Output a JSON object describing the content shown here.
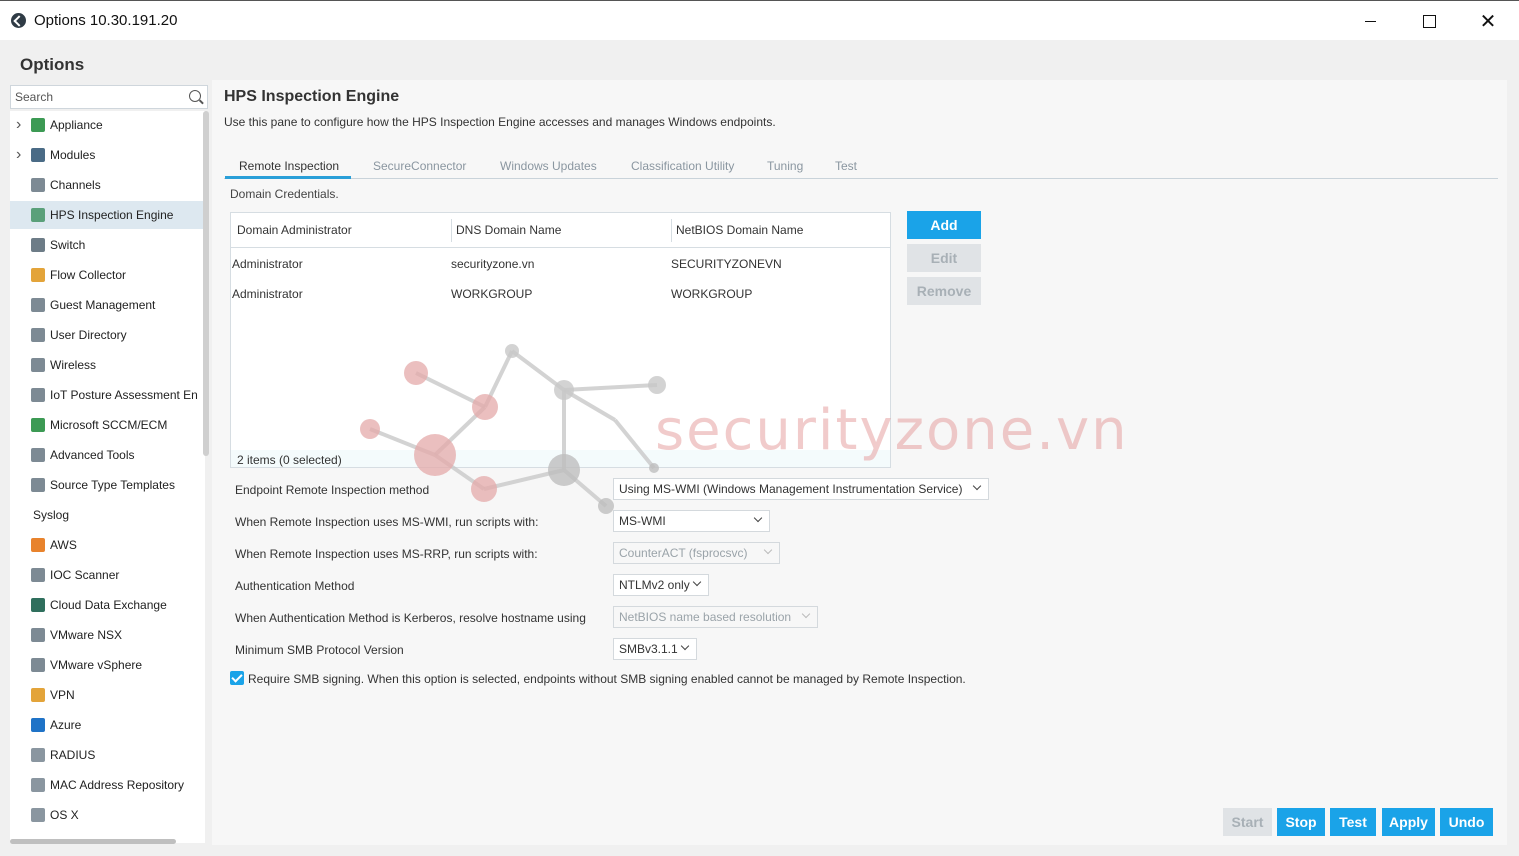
{
  "window": {
    "title": "Options 10.30.191.20"
  },
  "sidebar": {
    "heading": "Options",
    "search_placeholder": "Search",
    "items": [
      {
        "label": "Appliance",
        "expandable": true,
        "icon": "appliance-icon",
        "color": "#3c9a54"
      },
      {
        "label": "Modules",
        "expandable": true,
        "icon": "modules-icon",
        "color": "#4a6b86"
      },
      {
        "label": "Channels",
        "expandable": false,
        "icon": "channels-icon",
        "color": "#7d8a94"
      },
      {
        "label": "HPS Inspection Engine",
        "expandable": false,
        "icon": "hps-icon",
        "color": "#5aa07a",
        "selected": true
      },
      {
        "label": "Switch",
        "expandable": false,
        "icon": "switch-icon",
        "color": "#6d7c87"
      },
      {
        "label": "Flow Collector",
        "expandable": false,
        "icon": "flow-collector-icon",
        "color": "#e3a43a"
      },
      {
        "label": "Guest Management",
        "expandable": false,
        "icon": "guest-management-icon",
        "color": "#7d8a94"
      },
      {
        "label": "User Directory",
        "expandable": false,
        "icon": "user-directory-icon",
        "color": "#7d8a94"
      },
      {
        "label": "Wireless",
        "expandable": false,
        "icon": "wireless-icon",
        "color": "#7d8a94"
      },
      {
        "label": "IoT Posture Assessment En",
        "expandable": false,
        "icon": "iot-icon",
        "color": "#7d8a94"
      },
      {
        "label": "Microsoft SCCM/ECM",
        "expandable": false,
        "icon": "sccm-icon",
        "color": "#3c9a54"
      },
      {
        "label": "Advanced Tools",
        "expandable": false,
        "icon": "advanced-tools-icon",
        "color": "#7d8a94"
      },
      {
        "label": "Source Type Templates",
        "expandable": false,
        "icon": "source-type-icon",
        "color": "#7d8a94"
      },
      {
        "label": "Syslog",
        "expandable": false,
        "icon": "",
        "color": ""
      },
      {
        "label": "AWS",
        "expandable": false,
        "icon": "aws-cloud-icon",
        "color": "#e8832d"
      },
      {
        "label": "IOC Scanner",
        "expandable": false,
        "icon": "ioc-scanner-icon",
        "color": "#7d8a94"
      },
      {
        "label": "Cloud Data Exchange",
        "expandable": false,
        "icon": "cloud-data-exchange-icon",
        "color": "#2f6f5d"
      },
      {
        "label": "VMware NSX",
        "expandable": false,
        "icon": "vmware-nsx-icon",
        "color": "#7d8a94"
      },
      {
        "label": "VMware vSphere",
        "expandable": false,
        "icon": "vmware-vsphere-icon",
        "color": "#7d8a94"
      },
      {
        "label": "VPN",
        "expandable": false,
        "icon": "vpn-icon",
        "color": "#e3a43a"
      },
      {
        "label": "Azure",
        "expandable": false,
        "icon": "azure-icon",
        "color": "#1f73c7"
      },
      {
        "label": "RADIUS",
        "expandable": false,
        "icon": "radius-icon",
        "color": "#8a96a0"
      },
      {
        "label": "MAC Address Repository",
        "expandable": false,
        "icon": "mac-repo-icon",
        "color": "#8a96a0"
      },
      {
        "label": "OS X",
        "expandable": false,
        "icon": "apple-icon",
        "color": "#8a96a0"
      }
    ]
  },
  "pane": {
    "title": "HPS Inspection Engine",
    "description": "Use this pane to configure how the HPS Inspection Engine accesses and manages Windows endpoints.",
    "tabs": [
      "Remote Inspection",
      "SecureConnector",
      "Windows Updates",
      "Classification Utility",
      "Tuning",
      "Test"
    ],
    "active_tab": "Remote Inspection",
    "domain_label": "Domain Credentials.",
    "table": {
      "columns": [
        "Domain Administrator",
        "DNS Domain Name",
        "NetBIOS Domain Name"
      ],
      "rows": [
        [
          "Administrator",
          "securityzone.vn",
          "SECURITYZONEVN"
        ],
        [
          "Administrator",
          "WORKGROUP",
          "WORKGROUP"
        ]
      ],
      "footer": "2 items (0 selected)"
    },
    "table_buttons": {
      "add": "Add",
      "edit": "Edit",
      "remove": "Remove"
    },
    "form": {
      "method_label": "Endpoint Remote Inspection method",
      "method_value": "Using MS-WMI (Windows Management Instrumentation Service)",
      "wmi_label": "When Remote Inspection uses MS-WMI, run scripts with:",
      "wmi_value": "MS-WMI",
      "rrp_label": "When Remote Inspection uses MS-RRP, run scripts with:",
      "rrp_value": "CounterACT (fsprocsvc)",
      "auth_label": "Authentication Method",
      "auth_value": "NTLMv2 only",
      "kerberos_label": "When Authentication Method is Kerberos, resolve hostname using",
      "kerberos_value": "NetBIOS name based resolution",
      "smb_label": "Minimum SMB Protocol Version",
      "smb_value": "SMBv3.1.1",
      "smb_signing_label": "Require SMB signing. When this option is selected, endpoints without SMB signing enabled cannot be managed by Remote Inspection.",
      "smb_signing_checked": true
    },
    "watermark": "securityzone.vn"
  },
  "footer_buttons": {
    "start": "Start",
    "stop": "Stop",
    "test": "Test",
    "apply": "Apply",
    "undo": "Undo"
  },
  "colors": {
    "accent": "#1aa3e8",
    "tab_underline": "#2a9fd8",
    "selected_row": "#dde8f0"
  }
}
